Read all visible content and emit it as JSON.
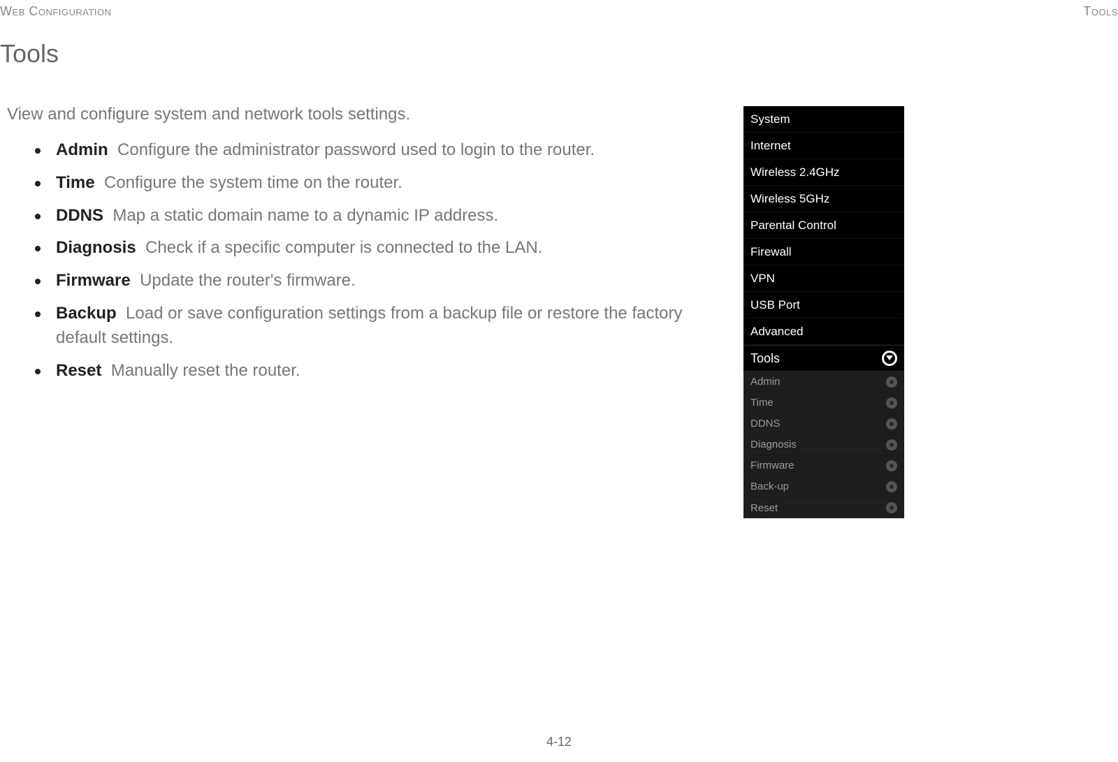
{
  "header": {
    "left": "Web Configuration",
    "right": "Tools"
  },
  "title": "Tools",
  "intro": "View and configure system and network tools settings.",
  "bullets": [
    {
      "label": "Admin",
      "desc": "Configure the administrator password used to login to the router."
    },
    {
      "label": "Time",
      "desc": "Configure the system time on the router."
    },
    {
      "label": "DDNS",
      "desc": "Map a static domain name to a dynamic IP address."
    },
    {
      "label": "Diagnosis",
      "desc": "Check if a specific computer is connected to the LAN."
    },
    {
      "label": "Firmware",
      "desc": "Update the router's firmware."
    },
    {
      "label": "Backup",
      "desc": "Load or save configuration settings from a backup file or restore the factory default settings."
    },
    {
      "label": "Reset",
      "desc": "Manually reset the router."
    }
  ],
  "menu": {
    "main": [
      "System",
      "Internet",
      "Wireless 2.4GHz",
      "Wireless 5GHz",
      "Parental Control",
      "Firewall",
      "VPN",
      "USB Port",
      "Advanced"
    ],
    "active": "Tools",
    "sub": [
      "Admin",
      "Time",
      "DDNS",
      "Diagnosis",
      "Firmware",
      "Back-up",
      "Reset"
    ]
  },
  "page_number": "4-12"
}
